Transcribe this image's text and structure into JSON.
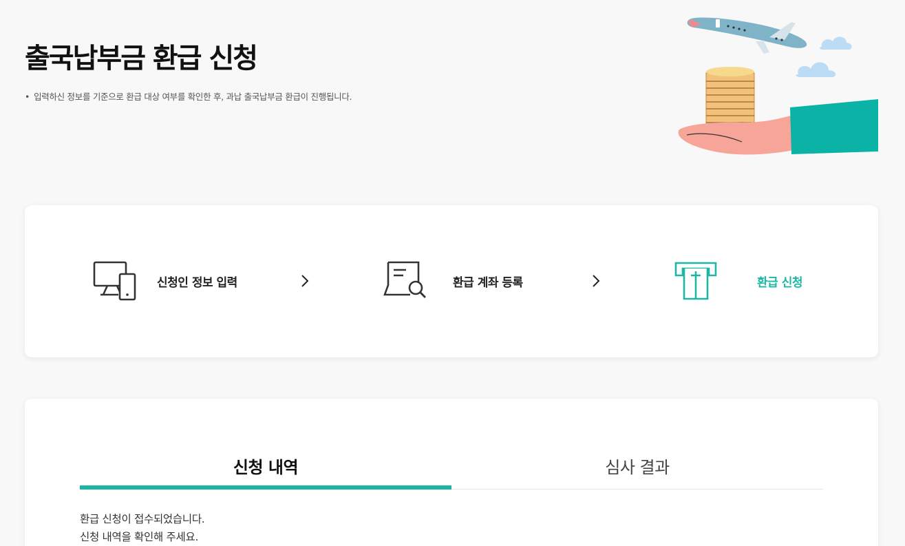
{
  "header": {
    "title": "출국납부금 환급 신청",
    "description": "입력하신 정보를 기준으로 환급 대상 여부를 확인한 후, 과납 출국납부금 환급이 진행됩니다."
  },
  "steps": [
    {
      "label": "신청인 정보 입력",
      "icon": "devices-icon",
      "state": "done"
    },
    {
      "label": "환급 계좌 등록",
      "icon": "document-search-icon",
      "state": "done"
    },
    {
      "label": "환급 신청",
      "icon": "atm-withdraw-icon",
      "state": "current"
    }
  ],
  "tabs": [
    {
      "label": "신청 내역",
      "active": true
    },
    {
      "label": "심사 결과",
      "active": false
    }
  ],
  "result": {
    "line1": "환급 신청이 접수되었습니다.",
    "line2": "신청 내역을 확인해 주세요."
  },
  "colors": {
    "accent": "#1bb7a4",
    "background": "#f8f8f8",
    "card": "#ffffff"
  }
}
